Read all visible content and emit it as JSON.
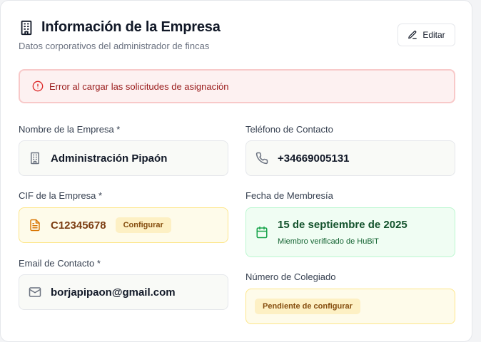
{
  "header": {
    "title": "Información de la Empresa",
    "subtitle": "Datos corporativos del administrador de fincas",
    "edit_label": "Editar"
  },
  "alert": {
    "message": "Error al cargar las solicitudes de asignación"
  },
  "fields": {
    "company_name": {
      "label": "Nombre de la Empresa *",
      "value": "Administración Pipaón"
    },
    "phone": {
      "label": "Teléfono de Contacto",
      "value": "+34669005131"
    },
    "cif": {
      "label": "CIF de la Empresa *",
      "value": "C12345678",
      "badge": "Configurar"
    },
    "membership": {
      "label": "Fecha de Membresía",
      "value": "15 de septiembre de 2025",
      "note": "Miembro verificado de HuBiT"
    },
    "email": {
      "label": "Email de Contacto *",
      "value": "borjapipaon@gmail.com"
    },
    "colegiado": {
      "label": "Número de Colegiado",
      "badge": "Pendiente de configurar"
    }
  },
  "colors": {
    "error_bg": "#fdf1f1",
    "error_text": "#991b1b",
    "warning_bg": "#fefbea",
    "success_bg": "#f0fdf3",
    "success_text": "#14532d"
  }
}
